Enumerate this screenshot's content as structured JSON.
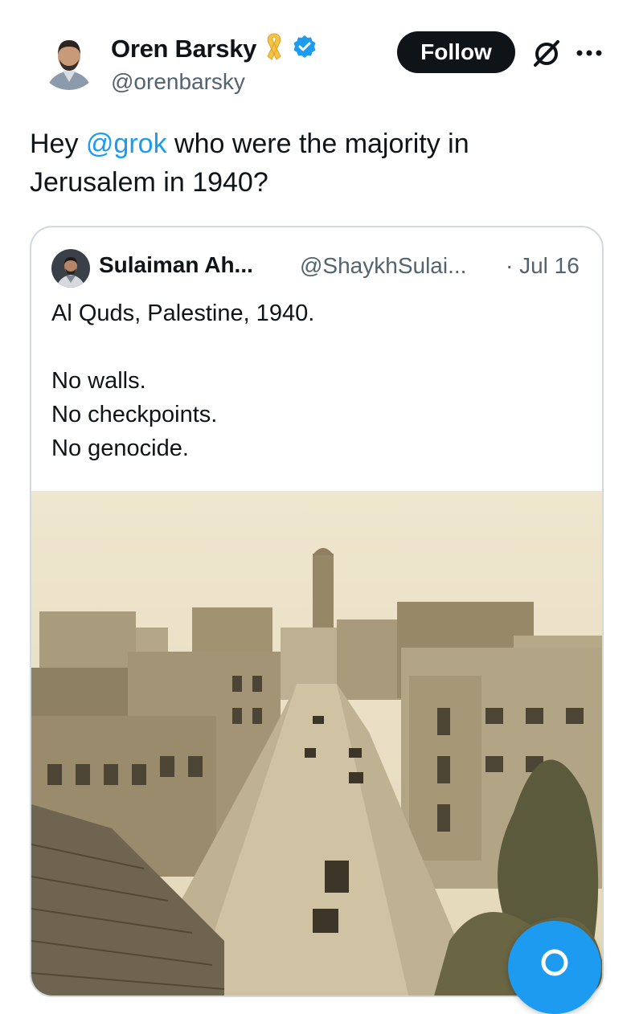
{
  "author": {
    "name": "Oren Barsky",
    "handle": "@orenbarsky",
    "ribbon_color": "#f5c242",
    "verified_color": "#1d9bf0"
  },
  "follow_label": "Follow",
  "tweet": {
    "prefix": "Hey ",
    "mention": "@grok",
    "line1_rest": " who were the majority in",
    "line2": "Jerusalem in 1940?"
  },
  "quoted": {
    "name": "Sulaiman Ah...",
    "handle": "@ShaykhSulai...",
    "date": "· Jul 16",
    "lines": [
      "Al Quds, Palestine, 1940.",
      "",
      "No walls.",
      "No checkpoints.",
      "No genocide."
    ]
  },
  "colors": {
    "accent": "#1d9bf0",
    "text": "#0f1419",
    "secondary": "#536471",
    "border": "#cfd9de",
    "photo_sepia": "#e7dcc0"
  }
}
